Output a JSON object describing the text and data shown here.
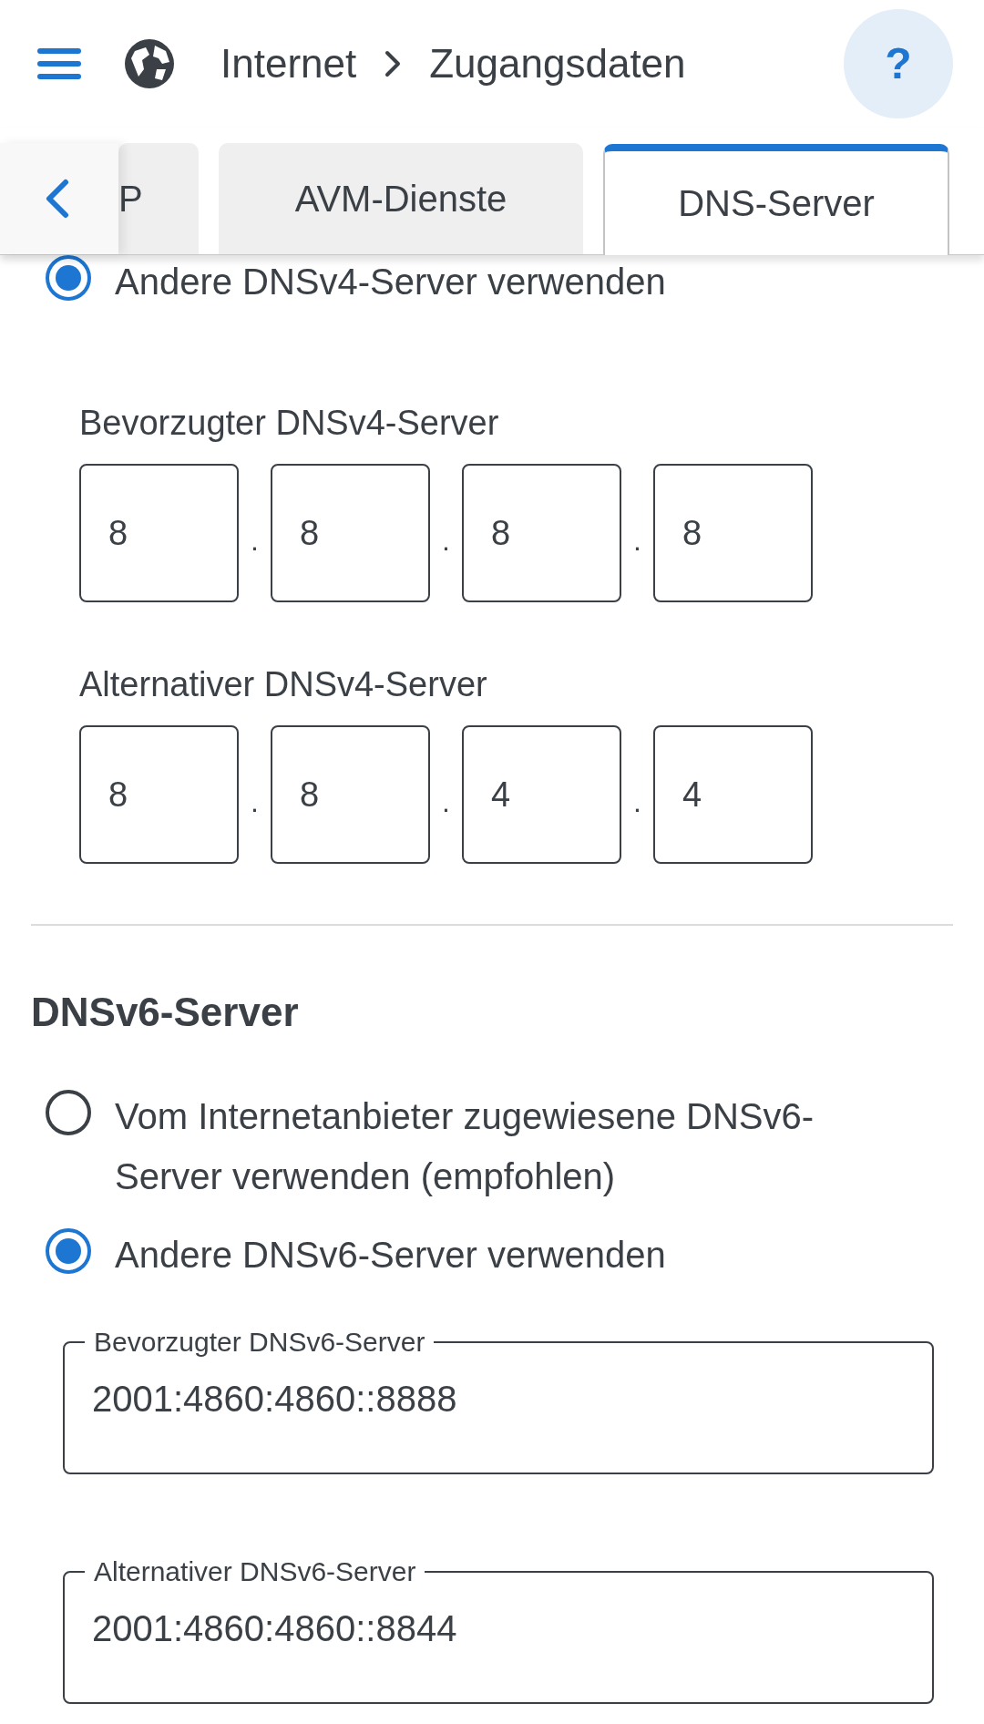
{
  "header": {
    "breadcrumb": [
      "Internet",
      "Zugangsdaten"
    ],
    "help": "?"
  },
  "tabs": [
    {
      "label": "P",
      "selected": false
    },
    {
      "label": "AVM-Dienste",
      "selected": false
    },
    {
      "label": "DNS-Server",
      "selected": true
    }
  ],
  "dnsv4": {
    "option": {
      "label": "Andere DNSv4-Server verwenden",
      "selected": true
    },
    "separator": ".",
    "fields": [
      {
        "label": "Bevorzugter DNSv4-Server",
        "octets": [
          "8",
          "8",
          "8",
          "8"
        ]
      },
      {
        "label": "Alternativer DNSv4-Server",
        "octets": [
          "8",
          "8",
          "4",
          "4"
        ]
      }
    ]
  },
  "dnsv6": {
    "title": "DNSv6-Server",
    "options": [
      {
        "label": "Vom Internetanbieter zugewiesene DNSv6-Server verwenden (empfohlen)",
        "selected": false
      },
      {
        "label": "Andere DNSv6-Server verwenden",
        "selected": true
      }
    ],
    "fields": [
      {
        "label": "Bevorzugter DNSv6-Server",
        "value": "2001:4860:4860::8888"
      },
      {
        "label": "Alternativer DNSv6-Server",
        "value": "2001:4860:4860::8844"
      }
    ]
  }
}
